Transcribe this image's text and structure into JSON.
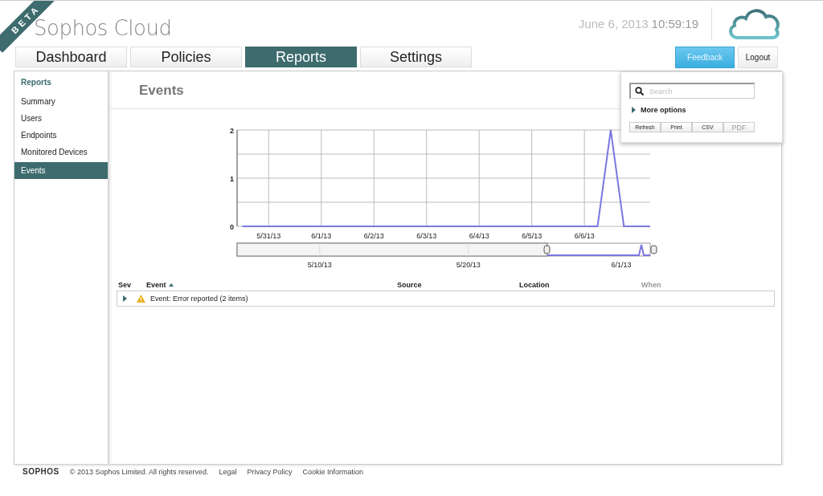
{
  "header": {
    "ribbon": "BETA",
    "title": "Sophos Cloud",
    "date": "June 6, 2013",
    "time": "10:59:19"
  },
  "tabs": [
    {
      "label": "Dashboard",
      "selected": false
    },
    {
      "label": "Policies",
      "selected": false
    },
    {
      "label": "Reports",
      "selected": true
    },
    {
      "label": "Settings",
      "selected": false
    }
  ],
  "account_buttons": [
    "Feedback",
    "Logout"
  ],
  "sidebar": {
    "heading": "Reports",
    "items": [
      {
        "label": "Summary",
        "selected": false
      },
      {
        "label": "Users",
        "selected": false
      },
      {
        "label": "Endpoints",
        "selected": false
      },
      {
        "label": "Monitored Devices",
        "selected": false
      },
      {
        "label": "Events",
        "selected": true
      }
    ]
  },
  "page_title": "Events",
  "chart": {
    "chart_data": {
      "type": "line",
      "categories": [
        null,
        null,
        "5/31/13",
        null,
        null,
        null,
        "6/1/13",
        null,
        null,
        null,
        "6/2/13",
        null,
        null,
        null,
        "6/3/13",
        null,
        null,
        null,
        "6/4/13",
        null,
        null,
        null,
        "6/5/13",
        null,
        null,
        null,
        "6/6/13",
        null,
        null,
        null,
        null,
        null
      ],
      "series": [
        {
          "color": "#7b78e0",
          "values": [
            0,
            0,
            0,
            0,
            0,
            0,
            0,
            0,
            0,
            0,
            0,
            0,
            0,
            0,
            0,
            0,
            0,
            0,
            0,
            0,
            0,
            0,
            0,
            0,
            0,
            0,
            0,
            0,
            2,
            0,
            0,
            0
          ]
        }
      ],
      "ylim": [
        0,
        2
      ],
      "yticks": [
        0,
        1,
        2
      ],
      "grid": true
    },
    "navigator_labels": [
      "5/10/13",
      "5/20/13",
      "6/1/13"
    ]
  },
  "table": {
    "columns": [
      {
        "label": "Sev",
        "sorted": false,
        "disabled": false
      },
      {
        "label": "Event",
        "sorted": true,
        "disabled": false
      },
      {
        "label": "Source",
        "sorted": false,
        "disabled": false
      },
      {
        "label": "Location",
        "sorted": false,
        "disabled": false
      },
      {
        "label": "When",
        "sorted": false,
        "disabled": true
      }
    ],
    "rows": [
      {
        "expanded": false,
        "event": "Event: Error reported (2 items)"
      }
    ]
  },
  "tools_popup": {
    "search": {
      "placeholder": "Search"
    },
    "more_options": {
      "label": "More options",
      "expanded": false
    },
    "buttons": [
      {
        "label": "Refresh",
        "disabled": false
      },
      {
        "label": "Print",
        "disabled": false
      },
      {
        "label": "CSV",
        "disabled": false
      },
      {
        "label": "PDF",
        "disabled": true
      }
    ]
  },
  "footer": {
    "logo": "SOPHOS",
    "copyright": "© 2013 Sophos Limited. All rights reserved.",
    "links": [
      "Legal",
      "Privacy Policy",
      "Cookie Information"
    ]
  }
}
